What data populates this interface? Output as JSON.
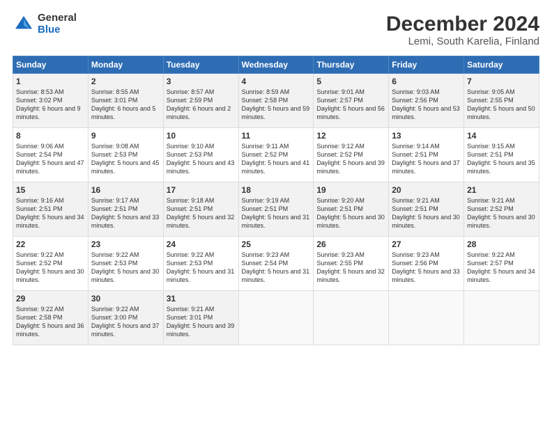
{
  "header": {
    "logo_general": "General",
    "logo_blue": "Blue",
    "title": "December 2024",
    "subtitle": "Lemi, South Karelia, Finland"
  },
  "weekdays": [
    "Sunday",
    "Monday",
    "Tuesday",
    "Wednesday",
    "Thursday",
    "Friday",
    "Saturday"
  ],
  "weeks": [
    [
      {
        "day": "1",
        "rise": "Sunrise: 8:53 AM",
        "set": "Sunset: 3:02 PM",
        "daylight": "Daylight: 6 hours and 9 minutes."
      },
      {
        "day": "2",
        "rise": "Sunrise: 8:55 AM",
        "set": "Sunset: 3:01 PM",
        "daylight": "Daylight: 6 hours and 5 minutes."
      },
      {
        "day": "3",
        "rise": "Sunrise: 8:57 AM",
        "set": "Sunset: 2:59 PM",
        "daylight": "Daylight: 6 hours and 2 minutes."
      },
      {
        "day": "4",
        "rise": "Sunrise: 8:59 AM",
        "set": "Sunset: 2:58 PM",
        "daylight": "Daylight: 5 hours and 59 minutes."
      },
      {
        "day": "5",
        "rise": "Sunrise: 9:01 AM",
        "set": "Sunset: 2:57 PM",
        "daylight": "Daylight: 5 hours and 56 minutes."
      },
      {
        "day": "6",
        "rise": "Sunrise: 9:03 AM",
        "set": "Sunset: 2:56 PM",
        "daylight": "Daylight: 5 hours and 53 minutes."
      },
      {
        "day": "7",
        "rise": "Sunrise: 9:05 AM",
        "set": "Sunset: 2:55 PM",
        "daylight": "Daylight: 5 hours and 50 minutes."
      }
    ],
    [
      {
        "day": "8",
        "rise": "Sunrise: 9:06 AM",
        "set": "Sunset: 2:54 PM",
        "daylight": "Daylight: 5 hours and 47 minutes."
      },
      {
        "day": "9",
        "rise": "Sunrise: 9:08 AM",
        "set": "Sunset: 2:53 PM",
        "daylight": "Daylight: 5 hours and 45 minutes."
      },
      {
        "day": "10",
        "rise": "Sunrise: 9:10 AM",
        "set": "Sunset: 2:53 PM",
        "daylight": "Daylight: 5 hours and 43 minutes."
      },
      {
        "day": "11",
        "rise": "Sunrise: 9:11 AM",
        "set": "Sunset: 2:52 PM",
        "daylight": "Daylight: 5 hours and 41 minutes."
      },
      {
        "day": "12",
        "rise": "Sunrise: 9:12 AM",
        "set": "Sunset: 2:52 PM",
        "daylight": "Daylight: 5 hours and 39 minutes."
      },
      {
        "day": "13",
        "rise": "Sunrise: 9:14 AM",
        "set": "Sunset: 2:51 PM",
        "daylight": "Daylight: 5 hours and 37 minutes."
      },
      {
        "day": "14",
        "rise": "Sunrise: 9:15 AM",
        "set": "Sunset: 2:51 PM",
        "daylight": "Daylight: 5 hours and 35 minutes."
      }
    ],
    [
      {
        "day": "15",
        "rise": "Sunrise: 9:16 AM",
        "set": "Sunset: 2:51 PM",
        "daylight": "Daylight: 5 hours and 34 minutes."
      },
      {
        "day": "16",
        "rise": "Sunrise: 9:17 AM",
        "set": "Sunset: 2:51 PM",
        "daylight": "Daylight: 5 hours and 33 minutes."
      },
      {
        "day": "17",
        "rise": "Sunrise: 9:18 AM",
        "set": "Sunset: 2:51 PM",
        "daylight": "Daylight: 5 hours and 32 minutes."
      },
      {
        "day": "18",
        "rise": "Sunrise: 9:19 AM",
        "set": "Sunset: 2:51 PM",
        "daylight": "Daylight: 5 hours and 31 minutes."
      },
      {
        "day": "19",
        "rise": "Sunrise: 9:20 AM",
        "set": "Sunset: 2:51 PM",
        "daylight": "Daylight: 5 hours and 30 minutes."
      },
      {
        "day": "20",
        "rise": "Sunrise: 9:21 AM",
        "set": "Sunset: 2:51 PM",
        "daylight": "Daylight: 5 hours and 30 minutes."
      },
      {
        "day": "21",
        "rise": "Sunrise: 9:21 AM",
        "set": "Sunset: 2:52 PM",
        "daylight": "Daylight: 5 hours and 30 minutes."
      }
    ],
    [
      {
        "day": "22",
        "rise": "Sunrise: 9:22 AM",
        "set": "Sunset: 2:52 PM",
        "daylight": "Daylight: 5 hours and 30 minutes."
      },
      {
        "day": "23",
        "rise": "Sunrise: 9:22 AM",
        "set": "Sunset: 2:53 PM",
        "daylight": "Daylight: 5 hours and 30 minutes."
      },
      {
        "day": "24",
        "rise": "Sunrise: 9:22 AM",
        "set": "Sunset: 2:53 PM",
        "daylight": "Daylight: 5 hours and 31 minutes."
      },
      {
        "day": "25",
        "rise": "Sunrise: 9:23 AM",
        "set": "Sunset: 2:54 PM",
        "daylight": "Daylight: 5 hours and 31 minutes."
      },
      {
        "day": "26",
        "rise": "Sunrise: 9:23 AM",
        "set": "Sunset: 2:55 PM",
        "daylight": "Daylight: 5 hours and 32 minutes."
      },
      {
        "day": "27",
        "rise": "Sunrise: 9:23 AM",
        "set": "Sunset: 2:56 PM",
        "daylight": "Daylight: 5 hours and 33 minutes."
      },
      {
        "day": "28",
        "rise": "Sunrise: 9:22 AM",
        "set": "Sunset: 2:57 PM",
        "daylight": "Daylight: 5 hours and 34 minutes."
      }
    ],
    [
      {
        "day": "29",
        "rise": "Sunrise: 9:22 AM",
        "set": "Sunset: 2:58 PM",
        "daylight": "Daylight: 5 hours and 36 minutes."
      },
      {
        "day": "30",
        "rise": "Sunrise: 9:22 AM",
        "set": "Sunset: 3:00 PM",
        "daylight": "Daylight: 5 hours and 37 minutes."
      },
      {
        "day": "31",
        "rise": "Sunrise: 9:21 AM",
        "set": "Sunset: 3:01 PM",
        "daylight": "Daylight: 5 hours and 39 minutes."
      },
      null,
      null,
      null,
      null
    ]
  ]
}
